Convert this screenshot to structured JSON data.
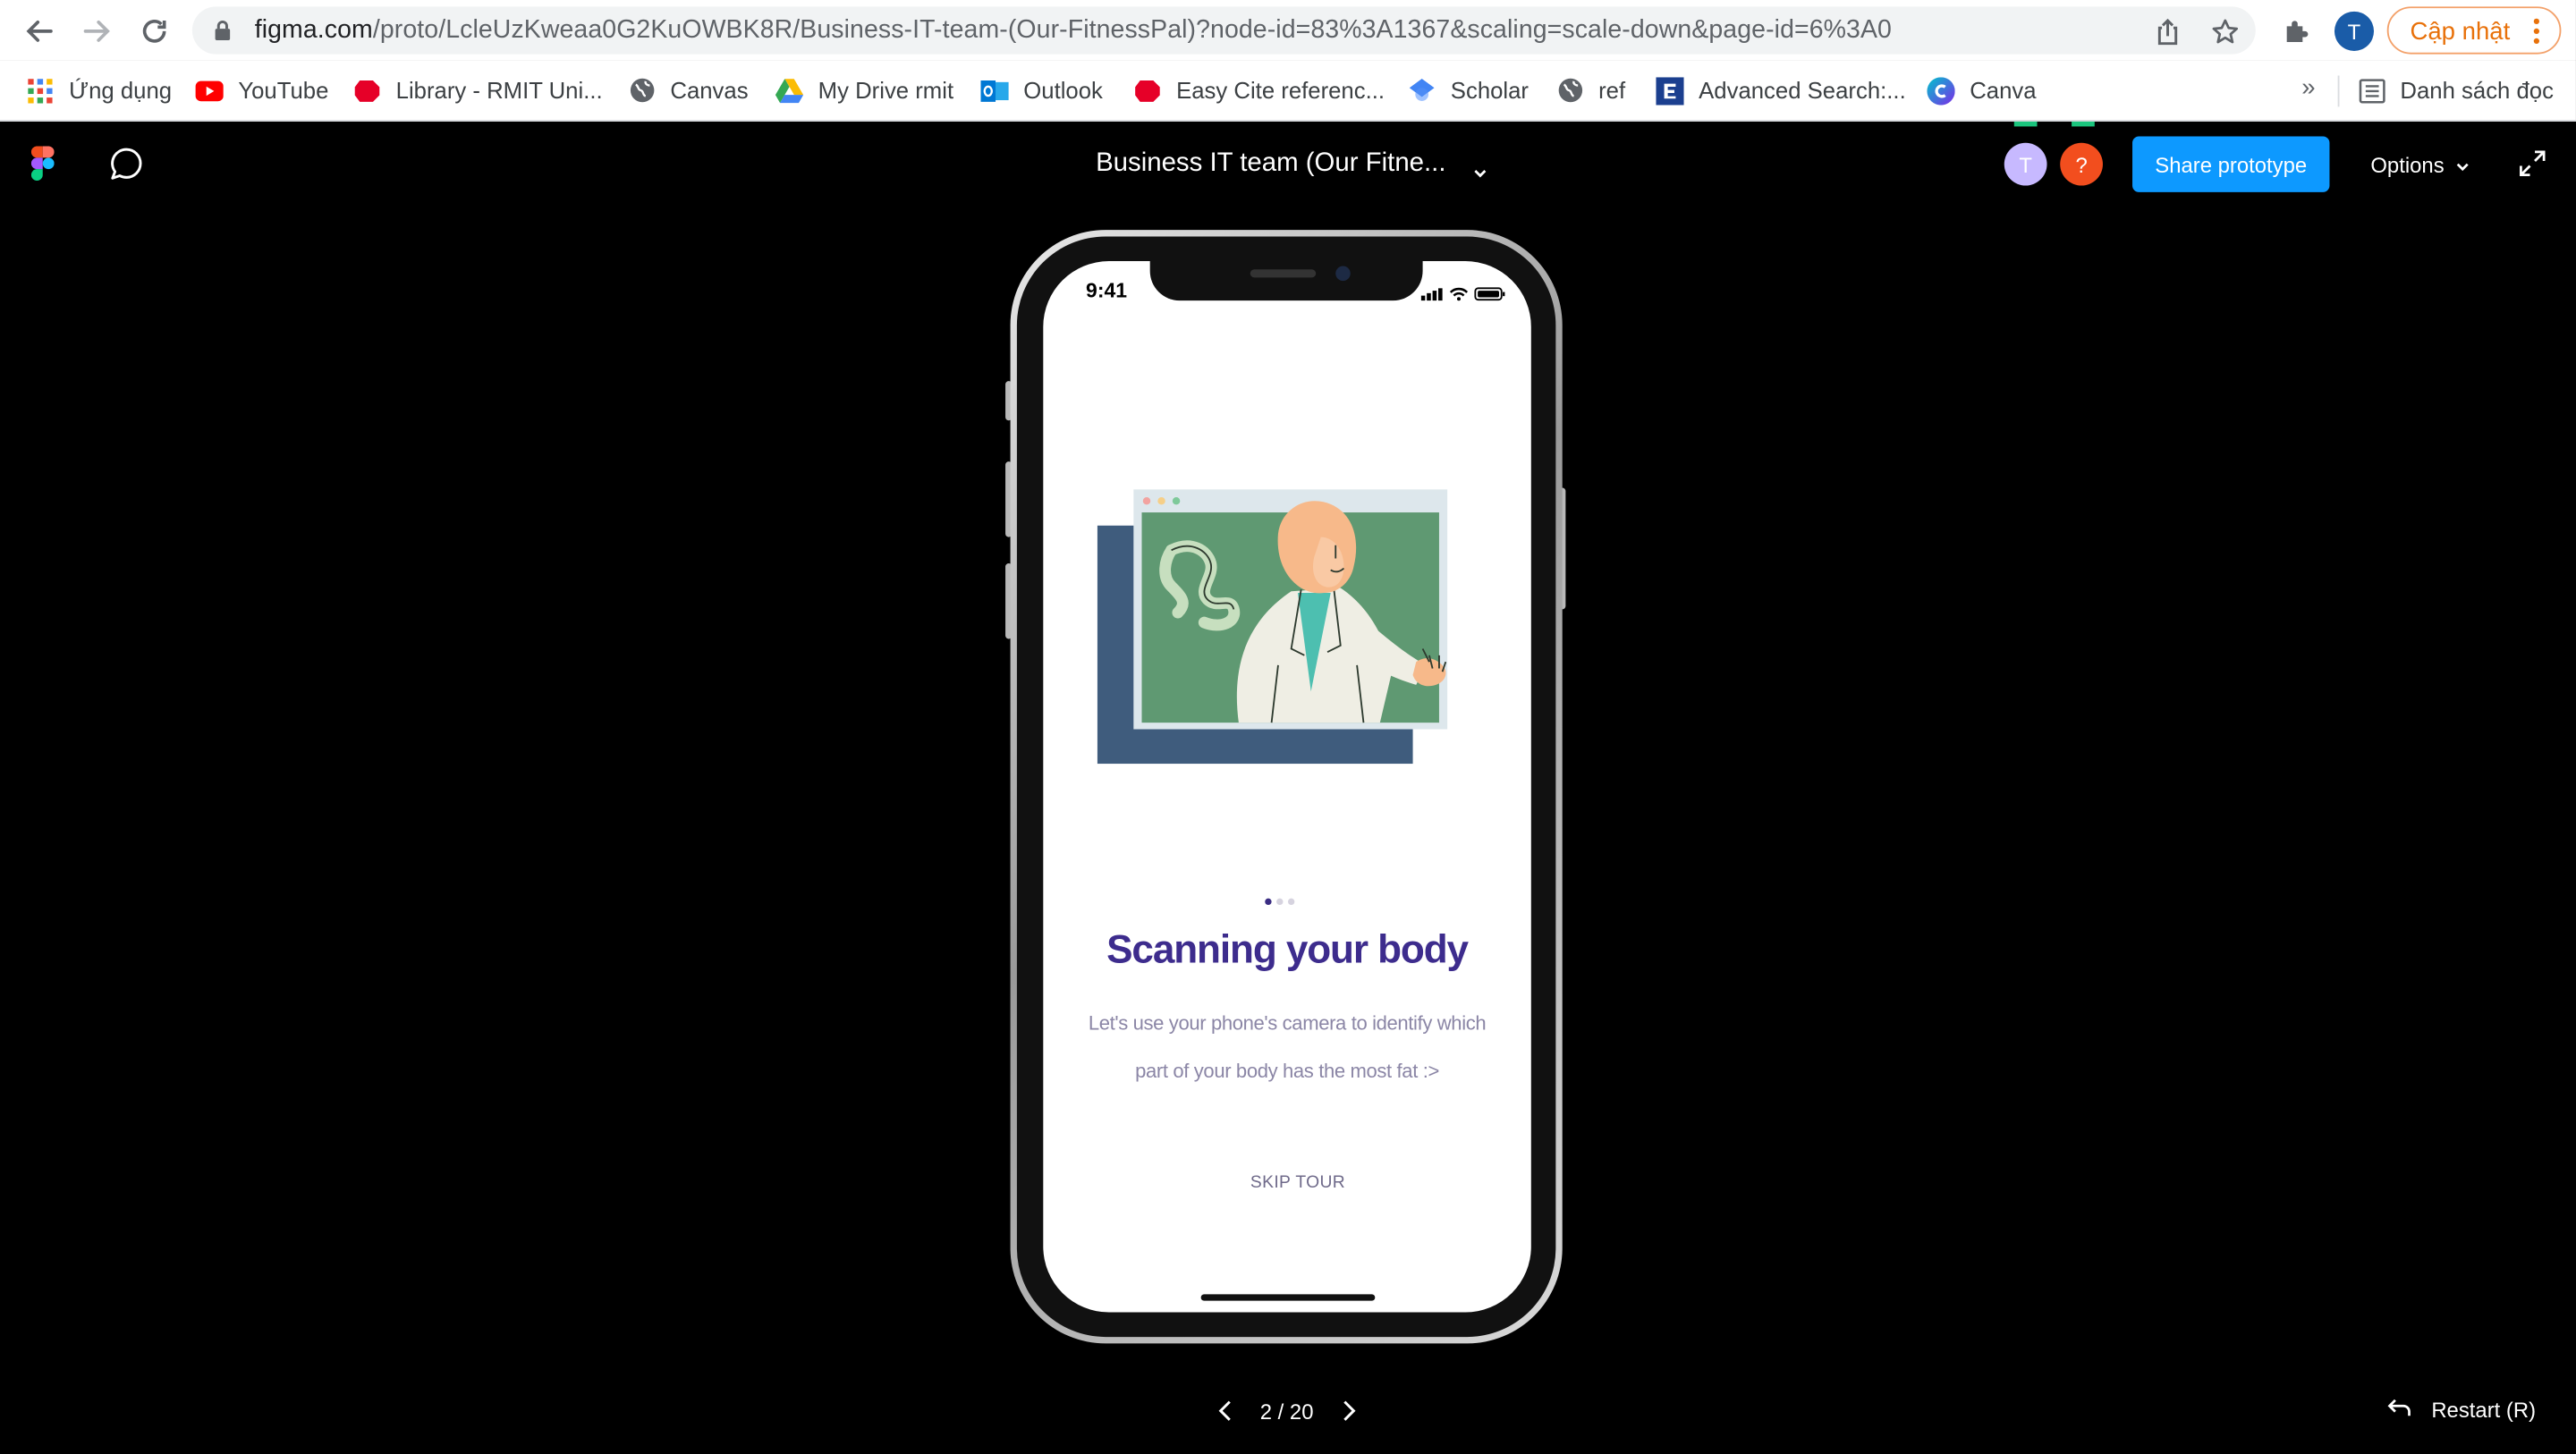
{
  "browser": {
    "url_domain": "figma.com",
    "url_path": "/proto/LcleUzKweaa0G2KuOWBK8R/Business-IT-team-(Our-FitnessPal)?node-id=83%3A1367&scaling=scale-down&page-id=6%3A0",
    "profile_initial": "T",
    "update_label": "Cập nhật",
    "icons": [
      "back-arrow-icon",
      "forward-arrow-icon",
      "reload-icon",
      "lock-icon",
      "share-icon",
      "star-icon",
      "puzzle-icon",
      "kebab-menu-icon"
    ]
  },
  "bookmarks": {
    "items": [
      {
        "label": "Ứng dụng",
        "icon": "apps-grid-icon"
      },
      {
        "label": "YouTube",
        "icon": "youtube-icon"
      },
      {
        "label": "Library - RMIT Uni...",
        "icon": "rmit-icon"
      },
      {
        "label": "Canvas",
        "icon": "globe-icon"
      },
      {
        "label": "My Drive rmit",
        "icon": "google-drive-icon"
      },
      {
        "label": "Outlook",
        "icon": "outlook-icon"
      },
      {
        "label": "Easy Cite referenc...",
        "icon": "rmit-icon"
      },
      {
        "label": "Scholar",
        "icon": "scholar-icon"
      },
      {
        "label": "ref",
        "icon": "globe-icon"
      },
      {
        "label": "Advanced Search:...",
        "icon": "elsevier-icon"
      },
      {
        "label": "Canva",
        "icon": "canva-icon"
      }
    ],
    "more": "»",
    "reading_list": "Danh sách đọc"
  },
  "figma": {
    "file_title": "Business IT team (Our Fitne...",
    "avatars": [
      {
        "initial": "T",
        "color": "#c7b9ff"
      },
      {
        "initial": "?",
        "color": "#f24e1e"
      }
    ],
    "share_label": "Share prototype",
    "options_label": "Options",
    "accent": "#0d99ff"
  },
  "screen": {
    "status_time": "9:41",
    "title": "Scanning your body",
    "description_line1": "Let's use your  phone's camera to identify which",
    "description_line2": "part of your  body has the most fat :>",
    "skip_label": "SKIP TOUR",
    "pager_current": 1,
    "pager_total": 3,
    "title_color": "#3d2c8d"
  },
  "footer": {
    "page_counter": "2 / 20",
    "restart_label": "Restart (R)"
  }
}
